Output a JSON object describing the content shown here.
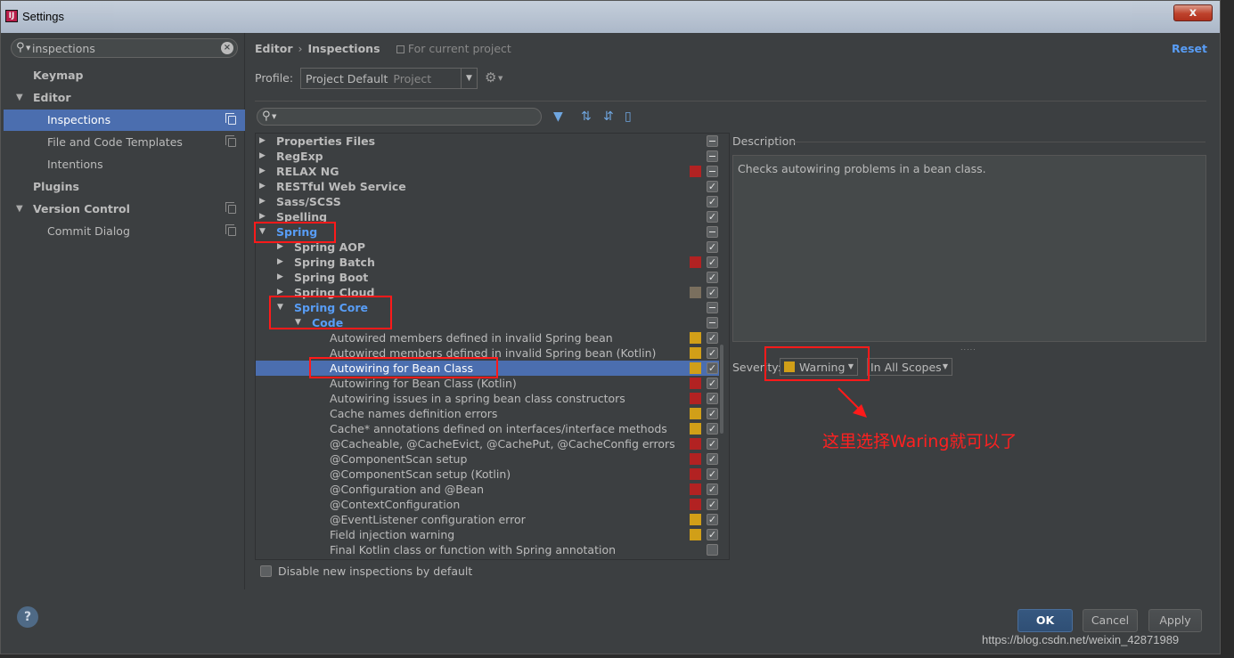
{
  "window": {
    "title": "Settings",
    "close_label": "x"
  },
  "search": {
    "value": "inspections"
  },
  "sidebar": {
    "items": [
      {
        "label": "Keymap"
      },
      {
        "label": "Editor"
      },
      {
        "label": "Inspections"
      },
      {
        "label": "File and Code Templates"
      },
      {
        "label": "Intentions"
      },
      {
        "label": "Plugins"
      },
      {
        "label": "Version Control"
      },
      {
        "label": "Commit Dialog"
      }
    ]
  },
  "header": {
    "crumb1": "Editor",
    "crumb_sep": "›",
    "crumb2": "Inspections",
    "scope": "For current project",
    "reset": "Reset"
  },
  "profile": {
    "label": "Profile:",
    "value": "Project Default",
    "sub": "Project"
  },
  "tree": {
    "rows": [
      {
        "label": "Properties Files"
      },
      {
        "label": "RegExp"
      },
      {
        "label": "RELAX NG"
      },
      {
        "label": "RESTful Web Service"
      },
      {
        "label": "Sass/SCSS"
      },
      {
        "label": "Spelling"
      },
      {
        "label": "Spring"
      },
      {
        "label": "Spring AOP"
      },
      {
        "label": "Spring Batch"
      },
      {
        "label": "Spring Boot"
      },
      {
        "label": "Spring Cloud"
      },
      {
        "label": "Spring Core"
      },
      {
        "label": "Code"
      },
      {
        "label": "Autowired members defined in invalid Spring bean"
      },
      {
        "label": "Autowired members defined in invalid Spring bean (Kotlin)"
      },
      {
        "label": "Autowiring for Bean Class"
      },
      {
        "label": "Autowiring for Bean Class (Kotlin)"
      },
      {
        "label": "Autowiring issues in a spring bean class constructors"
      },
      {
        "label": "Cache names definition errors"
      },
      {
        "label": "Cache* annotations defined on interfaces/interface methods"
      },
      {
        "label": "@Cacheable, @CacheEvict, @CachePut, @CacheConfig errors"
      },
      {
        "label": "@ComponentScan setup"
      },
      {
        "label": "@ComponentScan setup (Kotlin)"
      },
      {
        "label": "@Configuration and @Bean"
      },
      {
        "label": "@ContextConfiguration"
      },
      {
        "label": "@EventListener configuration error"
      },
      {
        "label": "Field injection warning"
      },
      {
        "label": "Final Kotlin class or function with Spring annotation"
      }
    ]
  },
  "colors": {
    "error": "#b22222",
    "warning": "#d19f18",
    "weak": "#7a6f5e",
    "selection": "#4b6eaf",
    "annotation": "#ff1a1a"
  },
  "options": {
    "disable_new": "Disable new inspections by default"
  },
  "description": {
    "title": "Description",
    "text": "Checks autowiring problems in a bean class."
  },
  "severity": {
    "label": "Severity:",
    "value": "Warning",
    "scope": "In All Scopes"
  },
  "annotation": {
    "text": "这里选择Waring就可以了"
  },
  "buttons": {
    "help": "?",
    "ok": "OK",
    "cancel": "Cancel",
    "apply": "Apply"
  },
  "watermark": "https://blog.csdn.net/weixin_42871989"
}
